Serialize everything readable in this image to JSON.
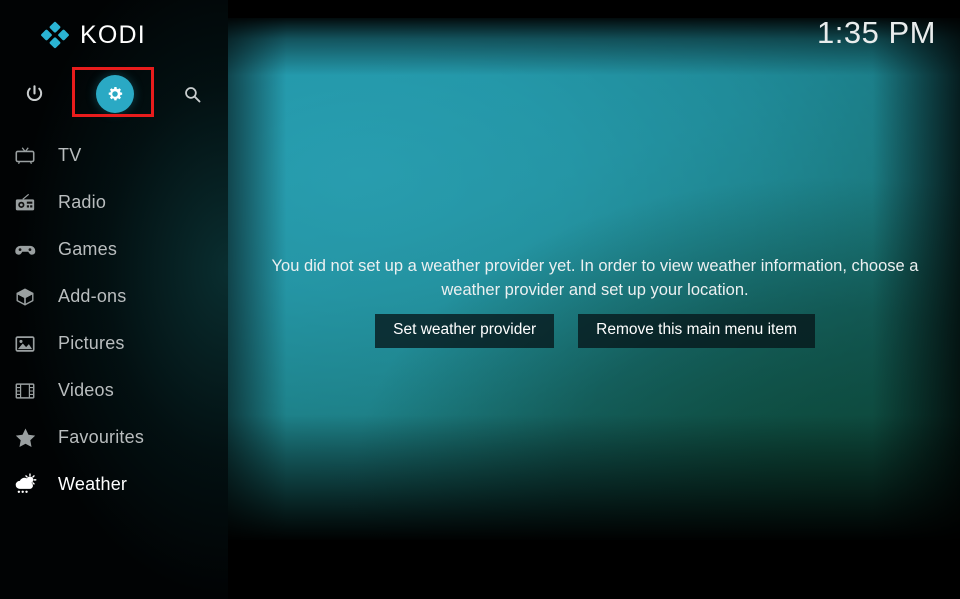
{
  "app": {
    "name": "KODI",
    "logo_icon": "kodi-diamond-logo",
    "accent_color": "#2aa9c4",
    "highlight_color": "#e81c1c"
  },
  "topbar": {
    "power_label": "Power",
    "power_icon": "power-icon",
    "settings_label": "Settings",
    "settings_icon": "gear-icon",
    "search_label": "Search",
    "search_icon": "search-icon"
  },
  "clock": {
    "time": "1:35 PM"
  },
  "sidebar": {
    "items": [
      {
        "label": "TV",
        "icon": "tv-icon",
        "active": false
      },
      {
        "label": "Radio",
        "icon": "radio-icon",
        "active": false
      },
      {
        "label": "Games",
        "icon": "gamepad-icon",
        "active": false
      },
      {
        "label": "Add-ons",
        "icon": "box-icon",
        "active": false
      },
      {
        "label": "Pictures",
        "icon": "picture-icon",
        "active": false
      },
      {
        "label": "Videos",
        "icon": "filmstrip-icon",
        "active": false
      },
      {
        "label": "Favourites",
        "icon": "star-icon",
        "active": false
      },
      {
        "label": "Weather",
        "icon": "weather-icon",
        "active": true
      }
    ]
  },
  "main": {
    "message": "You did not set up a weather provider yet. In order to view weather information, choose a weather provider and set up your location.",
    "buttons": [
      {
        "label": "Set weather provider"
      },
      {
        "label": "Remove this main menu item"
      }
    ]
  }
}
